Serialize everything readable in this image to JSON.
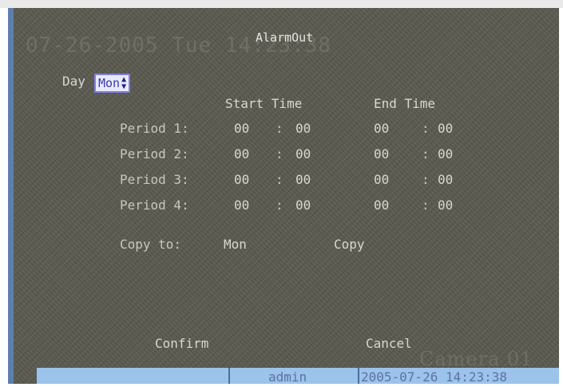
{
  "osd": {
    "datetime_overlay": "07-26-2005 Tue 14:23:38",
    "camera_overlay": "Camera 01"
  },
  "title": "AlarmOut",
  "day": {
    "label": "Day",
    "value": "Mon"
  },
  "headers": {
    "start": "Start Time",
    "end": "End Time"
  },
  "periods": [
    {
      "label": "Period 1:",
      "start_h": "00",
      "start_m": "00",
      "end_h": "00",
      "end_m": "00"
    },
    {
      "label": "Period 2:",
      "start_h": "00",
      "start_m": "00",
      "end_h": "00",
      "end_m": "00"
    },
    {
      "label": "Period 3:",
      "start_h": "00",
      "start_m": "00",
      "end_h": "00",
      "end_m": "00"
    },
    {
      "label": "Period 4:",
      "start_h": "00",
      "start_m": "00",
      "end_h": "00",
      "end_m": "00"
    }
  ],
  "time_separator": ":",
  "copy": {
    "label": "Copy to:",
    "target": "Mon",
    "button": "Copy"
  },
  "buttons": {
    "confirm": "Confirm",
    "cancel": "Cancel"
  },
  "status_bar": {
    "user": "admin",
    "datetime": "2005-07-26 14:23:38"
  },
  "colors": {
    "osd_background": "#5a5a50",
    "status_bar": "#9cc3ea",
    "selector_bg": "#e9e9ff"
  }
}
